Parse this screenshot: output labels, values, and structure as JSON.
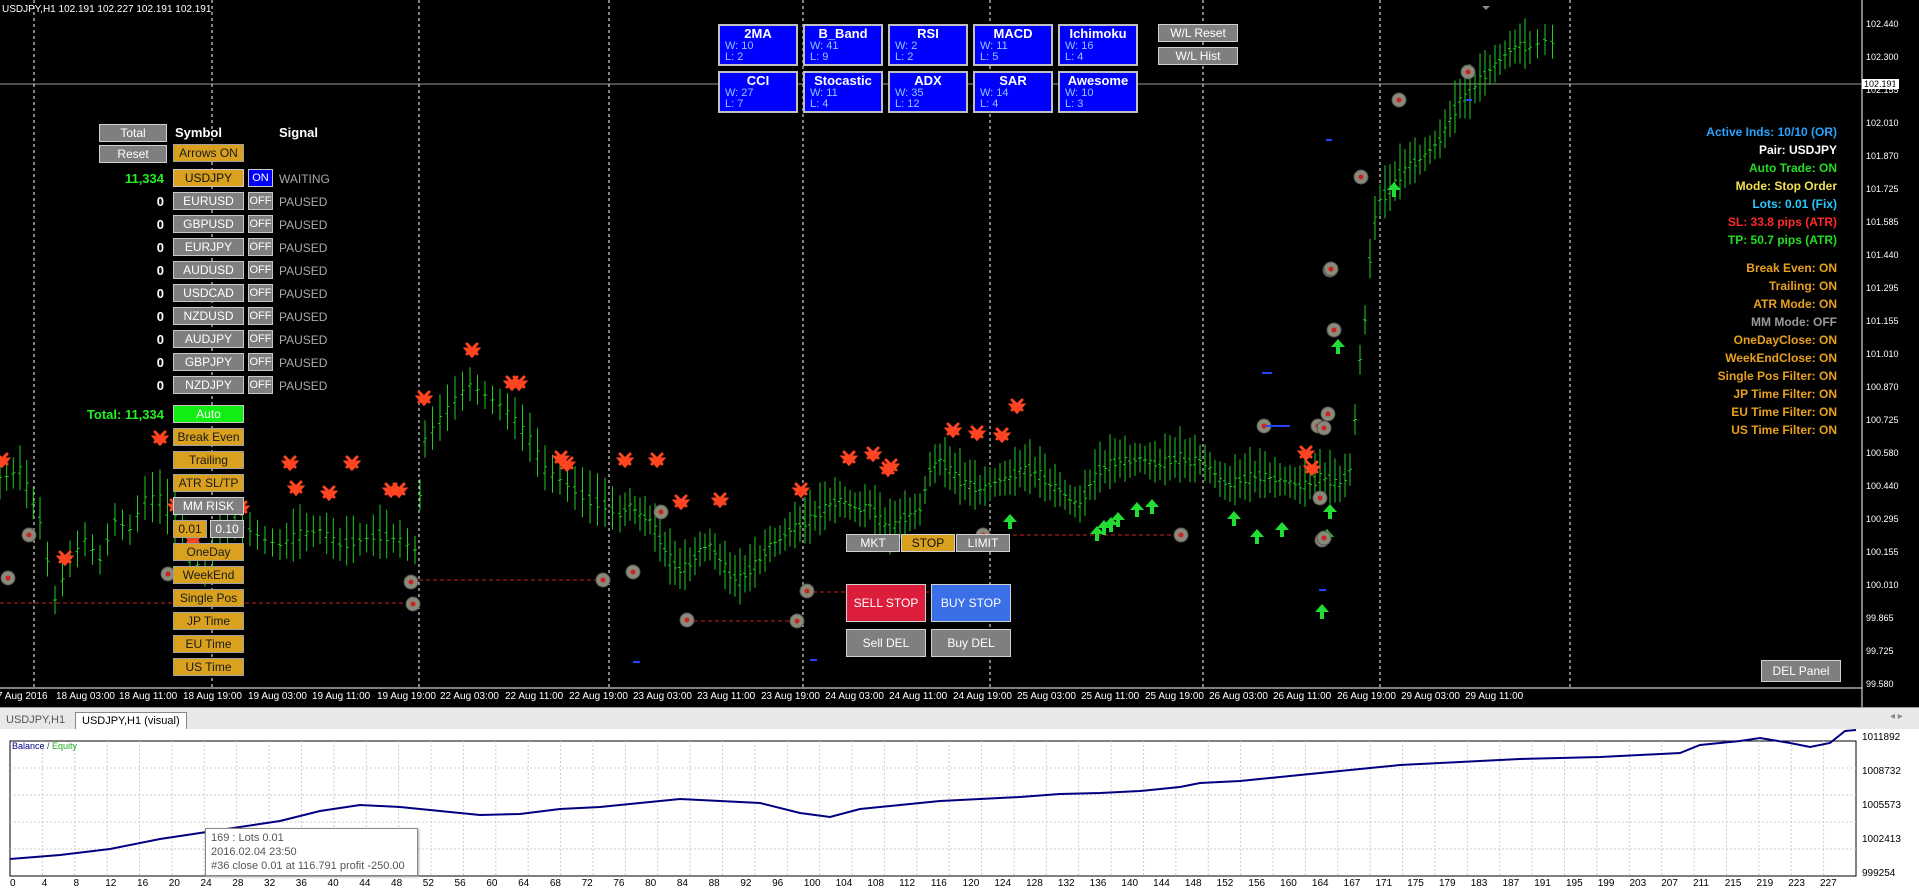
{
  "header": {
    "title": "USDJPY,H1  102.191 102.227 102.191 102.191"
  },
  "indicators": [
    {
      "name": "2MA",
      "w": "W: 10",
      "l": "L: 2"
    },
    {
      "name": "B_Band",
      "w": "W: 41",
      "l": "L: 9"
    },
    {
      "name": "RSI",
      "w": "W: 2",
      "l": "L: 2"
    },
    {
      "name": "MACD",
      "w": "W: 11",
      "l": "L: 5"
    },
    {
      "name": "Ichimoku",
      "w": "W: 16",
      "l": "L: 4"
    },
    {
      "name": "CCI",
      "w": "W: 27",
      "l": "L: 7"
    },
    {
      "name": "Stocastic",
      "w": "W: 11",
      "l": "L: 4"
    },
    {
      "name": "ADX",
      "w": "W: 35",
      "l": "L: 12"
    },
    {
      "name": "SAR",
      "w": "W: 14",
      "l": "L: 4"
    },
    {
      "name": "Awesome",
      "w": "W: 10",
      "l": "L: 3"
    }
  ],
  "wl_buttons": {
    "reset": "W/L Reset",
    "hist": "W/L Hist"
  },
  "panel": {
    "total_btn": "Total",
    "reset_btn": "Reset",
    "symbol_header": "Symbol",
    "signal_header": "Signal",
    "arrows_btn": "Arrows ON",
    "rows": [
      {
        "pnl": "11,334",
        "symbol": "USDJPY",
        "state": "ON",
        "signal": "WAITING",
        "active": true
      },
      {
        "pnl": "0",
        "symbol": "EURUSD",
        "state": "OFF",
        "signal": "PAUSED",
        "active": false
      },
      {
        "pnl": "0",
        "symbol": "GBPUSD",
        "state": "OFF",
        "signal": "PAUSED",
        "active": false
      },
      {
        "pnl": "0",
        "symbol": "EURJPY",
        "state": "OFF",
        "signal": "PAUSED",
        "active": false
      },
      {
        "pnl": "0",
        "symbol": "AUDUSD",
        "state": "OFF",
        "signal": "PAUSED",
        "active": false
      },
      {
        "pnl": "0",
        "symbol": "USDCAD",
        "state": "OFF",
        "signal": "PAUSED",
        "active": false
      },
      {
        "pnl": "0",
        "symbol": "NZDUSD",
        "state": "OFF",
        "signal": "PAUSED",
        "active": false
      },
      {
        "pnl": "0",
        "symbol": "AUDJPY",
        "state": "OFF",
        "signal": "PAUSED",
        "active": false
      },
      {
        "pnl": "0",
        "symbol": "GBPJPY",
        "state": "OFF",
        "signal": "PAUSED",
        "active": false
      },
      {
        "pnl": "0",
        "symbol": "NZDJPY",
        "state": "OFF",
        "signal": "PAUSED",
        "active": false
      }
    ],
    "total_label": "Total: 11,334",
    "settings": [
      "Break Even",
      "Trailing",
      "ATR SL/TP",
      "MM RISK"
    ],
    "lot1": "0.01",
    "lot2": "0.10",
    "filters": [
      "OneDay",
      "WeekEnd",
      "Single Pos",
      "JP Time",
      "EU Time",
      "US Time"
    ],
    "auto_btn": "Auto"
  },
  "orders": {
    "mkt": "MKT",
    "stop": "STOP",
    "limit": "LIMIT",
    "sell_stop": "SELL STOP",
    "buy_stop": "BUY STOP",
    "sell_del": "Sell DEL",
    "buy_del": "Buy DEL"
  },
  "info_lines": [
    {
      "text": "Active Inds: 10/10 (OR)",
      "color": "#29a3ff"
    },
    {
      "text": "Pair: USDJPY",
      "color": "#ffffff"
    },
    {
      "text": "Auto Trade: ON",
      "color": "#22dd22"
    },
    {
      "text": "Mode: Stop Order",
      "color": "#f0e050"
    },
    {
      "text": "Lots: 0.01 (Fix)",
      "color": "#29c8ff"
    },
    {
      "text": "SL: 33.8 pips (ATR)",
      "color": "#ff2a2a"
    },
    {
      "text": "TP: 50.7 pips (ATR)",
      "color": "#22dd22"
    },
    {
      "text": "Break Even: ON",
      "color": "#e8a020"
    },
    {
      "text": "Trailing: ON",
      "color": "#e8a020"
    },
    {
      "text": "ATR Mode: ON",
      "color": "#e8a020"
    },
    {
      "text": "MM Mode: OFF",
      "color": "#9a9a9a"
    },
    {
      "text": "OneDayClose: ON",
      "color": "#e8a020"
    },
    {
      "text": "WeekEndClose: ON",
      "color": "#e8a020"
    },
    {
      "text": "Single Pos Filter: ON",
      "color": "#e8a020"
    },
    {
      "text": "JP Time Filter: ON",
      "color": "#e8a020"
    },
    {
      "text": "EU Time Filter: ON",
      "color": "#e8a020"
    },
    {
      "text": "US Time Filter: ON",
      "color": "#e8a020"
    }
  ],
  "del_panel": "DEL Panel",
  "price_axis": [
    "102.440",
    "102.300",
    "102.191",
    "102.155",
    "102.010",
    "101.870",
    "101.725",
    "101.585",
    "101.440",
    "101.295",
    "101.155",
    "101.010",
    "100.870",
    "100.725",
    "100.580",
    "100.440",
    "100.295",
    "100.155",
    "100.010",
    "99.865",
    "99.725",
    "99.580"
  ],
  "time_axis": [
    "7 Aug 2016",
    "18 Aug 03:00",
    "18 Aug 11:00",
    "18 Aug 19:00",
    "19 Aug 03:00",
    "19 Aug 11:00",
    "19 Aug 19:00",
    "22 Aug 03:00",
    "22 Aug 11:00",
    "22 Aug 19:00",
    "23 Aug 03:00",
    "23 Aug 11:00",
    "23 Aug 19:00",
    "24 Aug 03:00",
    "24 Aug 11:00",
    "24 Aug 19:00",
    "25 Aug 03:00",
    "25 Aug 11:00",
    "25 Aug 19:00",
    "26 Aug 03:00",
    "26 Aug 11:00",
    "26 Aug 19:00",
    "29 Aug 03:00",
    "29 Aug 11:00"
  ],
  "tabs": [
    "USDJPY,H1",
    "USDJPY,H1 (visual)"
  ],
  "equity": {
    "legend_balance": "Balance",
    "legend_sep": " / ",
    "legend_equity": "Equity",
    "y_axis": [
      "1011892",
      "1008732",
      "1005573",
      "1002413",
      "999254"
    ],
    "x_axis": [
      "0",
      "4",
      "8",
      "12",
      "16",
      "20",
      "24",
      "28",
      "32",
      "36",
      "40",
      "44",
      "48",
      "52",
      "56",
      "60",
      "64",
      "68",
      "72",
      "76",
      "80",
      "84",
      "88",
      "92",
      "96",
      "100",
      "104",
      "108",
      "112",
      "116",
      "120",
      "124",
      "128",
      "132",
      "136",
      "140",
      "144",
      "148",
      "152",
      "156",
      "160",
      "164",
      "167",
      "171",
      "175",
      "179",
      "183",
      "187",
      "191",
      "195",
      "199",
      "203",
      "207",
      "211",
      "215",
      "219",
      "223",
      "227"
    ],
    "tooltip": [
      "169 : Lots 0.01",
      "2016.02.04 23:50",
      "#36 close 0.01 at 116.791 profit -250.00"
    ]
  },
  "colors": {
    "bull": "#22cc22",
    "sell_arrow": "#ff4422",
    "buy_arrow": "#22dd33",
    "panel_blue": "#0000ff"
  }
}
